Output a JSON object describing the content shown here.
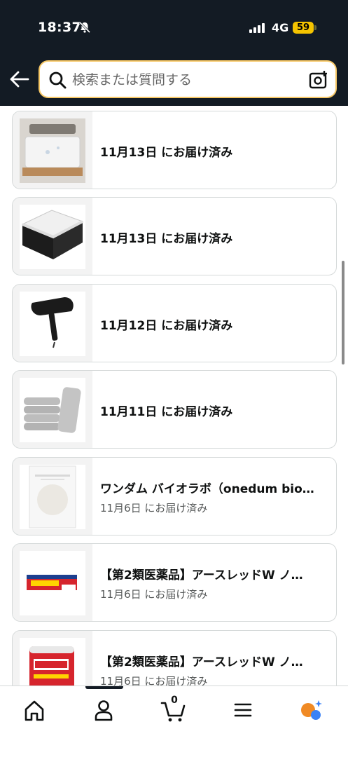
{
  "status_bar": {
    "time": "18:37",
    "network": "4G",
    "battery": "59"
  },
  "search": {
    "placeholder": "検索または質問する"
  },
  "orders": [
    {
      "title": "",
      "status": "11月13日 にお届け済み",
      "image": "bed-mattress-white"
    },
    {
      "title": "",
      "status": "11月13日 にお届け済み",
      "image": "pocket-coil-mattress"
    },
    {
      "title": "",
      "status": "11月12日 にお届け済み",
      "image": "hair-dryer-black"
    },
    {
      "title": "",
      "status": "11月11日 にお届け済み",
      "image": "folded-gray-towels"
    },
    {
      "title": "ワンダム バイオラボ（onedum bio…",
      "status": "11月6日 にお届け済み",
      "image": "onedum-bio-pack"
    },
    {
      "title": "【第2類医薬品】アースレッドW ノ…",
      "status": "11月6日 にお届け済み",
      "image": "earth-red-box"
    },
    {
      "title": "【第2類医薬品】アースレッドW ノ…",
      "status": "11月6日 にお届け済み",
      "image": "earth-red-can"
    }
  ],
  "bottom_nav": {
    "items": [
      "home-icon",
      "account-icon",
      "cart-icon",
      "menu-icon",
      "rufus-icon"
    ],
    "cart_count": "0"
  },
  "colors": {
    "header_bg": "#131b24",
    "search_border": "#f7c866",
    "battery": "#f5c400",
    "rufus_orange": "#f08a24",
    "rufus_blue": "#3b82f6"
  }
}
